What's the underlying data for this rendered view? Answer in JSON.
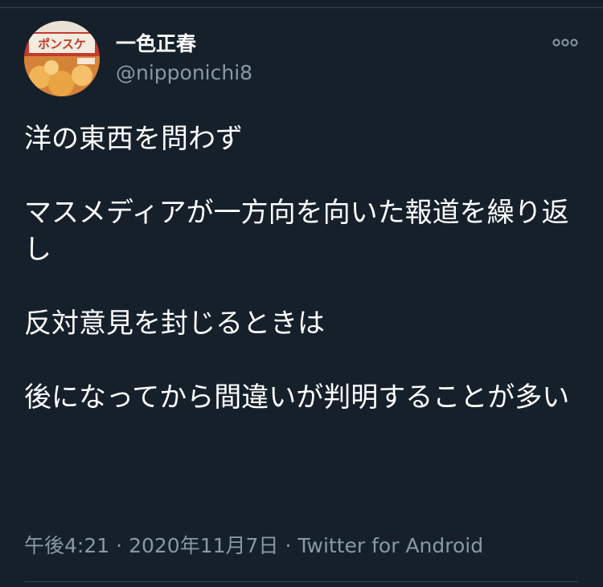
{
  "tweet": {
    "display_name": "一色正春",
    "handle": "@nipponichi8",
    "avatar": {
      "label": "ポンスケ",
      "colors": {
        "primary": "#b5372b",
        "accent": "#e8a23a"
      }
    },
    "paragraphs": [
      "洋の東西を問わず",
      "マスメディアが一方向を向いた報道を繰り返し",
      "反対意見を封じるときは",
      "後になってから間違いが判明することが多い"
    ],
    "time": "午後4:21",
    "date": "2020年11月7日",
    "separator": "·",
    "source": "Twitter for Android",
    "more_icon": "more-horizontal-icon"
  },
  "theme": {
    "background": "#15202b",
    "text": "#ffffff",
    "muted": "#8899a6",
    "border": "#38444d"
  }
}
